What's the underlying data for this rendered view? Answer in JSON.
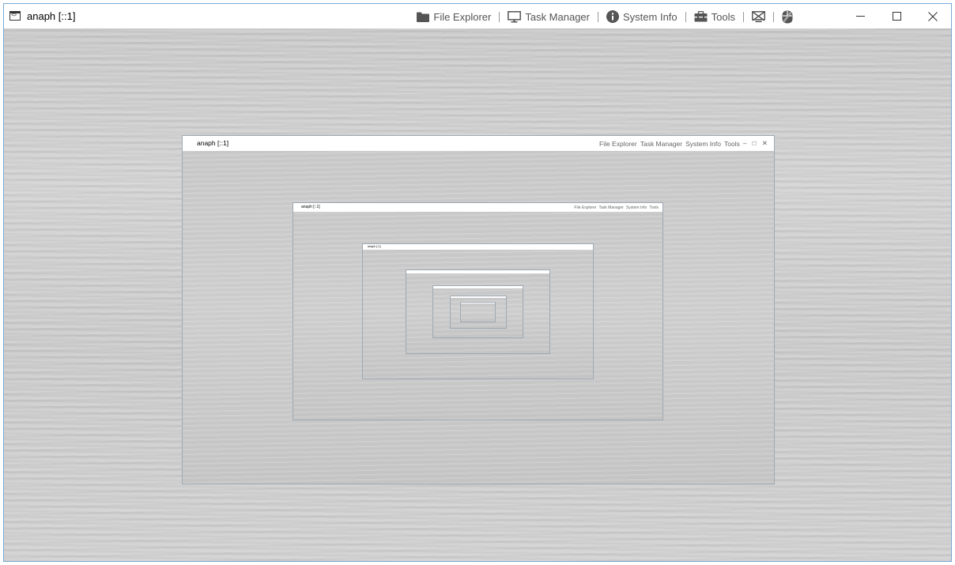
{
  "window": {
    "title": "anaph [::1]",
    "menu": {
      "file_explorer": "File Explorer",
      "task_manager": "Task Manager",
      "system_info": "System Info",
      "tools": "Tools"
    }
  },
  "colors": {
    "titlebar_bg": "#ffffff",
    "frame_border": "#7aa7d6",
    "desktop_bg": "#cdcdcd",
    "icon_color": "#555555"
  }
}
